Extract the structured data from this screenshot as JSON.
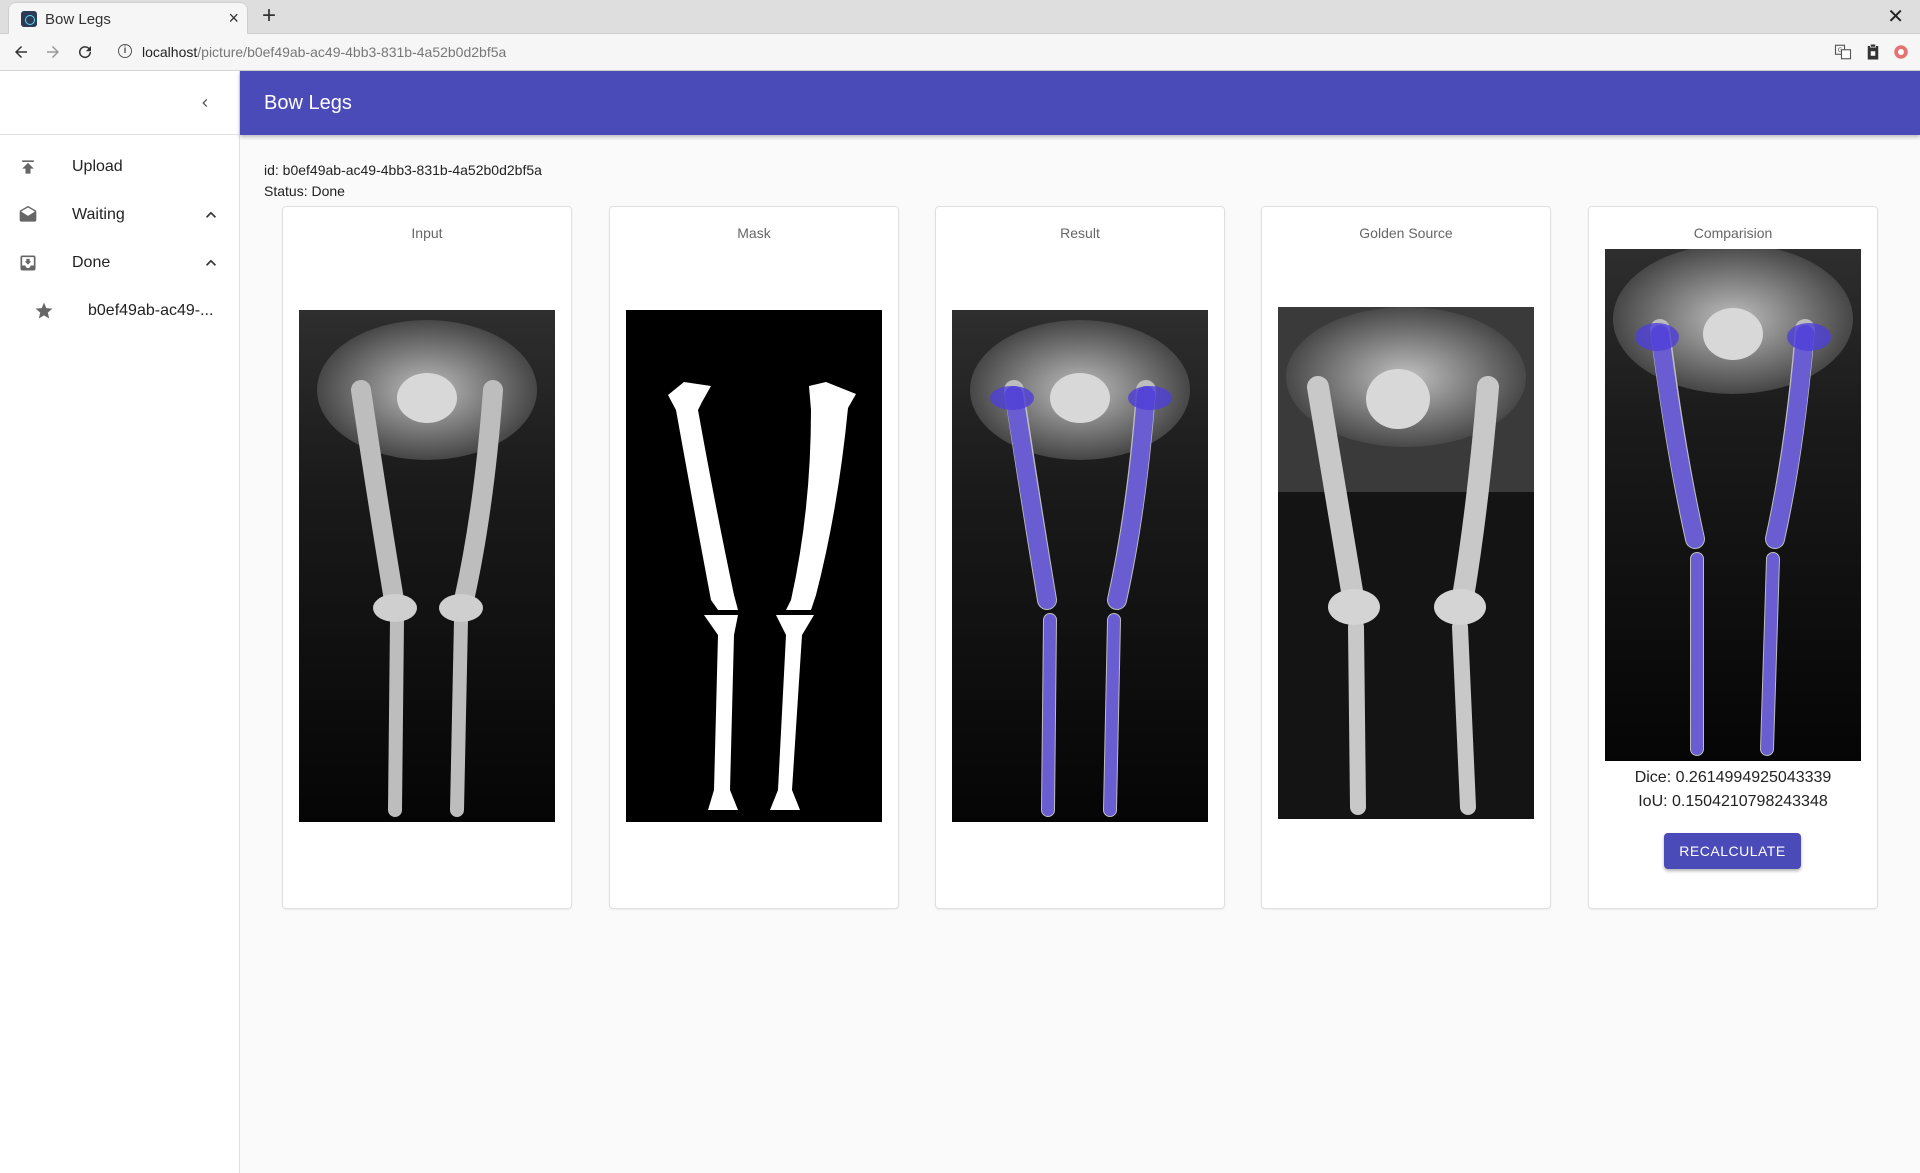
{
  "browser": {
    "tab_title": "Bow Legs",
    "url_host": "localhost",
    "url_path": "/picture/b0ef49ab-ac49-4bb3-831b-4a52b0d2bf5a"
  },
  "app": {
    "title": "Bow Legs"
  },
  "sidebar": {
    "items": [
      {
        "label": "Upload",
        "icon": "upload-icon"
      },
      {
        "label": "Waiting",
        "icon": "drafts-icon",
        "expanded": true
      },
      {
        "label": "Done",
        "icon": "move-to-inbox-icon",
        "expanded": true
      },
      {
        "label": "b0ef49ab-ac49-...",
        "icon": "star-icon"
      }
    ]
  },
  "picture": {
    "id_line": "id: b0ef49ab-ac49-4bb3-831b-4a52b0d2bf5a",
    "status_line": "Status: Done"
  },
  "cards": [
    {
      "title": "Input"
    },
    {
      "title": "Mask"
    },
    {
      "title": "Result"
    },
    {
      "title": "Golden Source"
    },
    {
      "title": "Comparision"
    }
  ],
  "comparison": {
    "dice": "Dice: 0.2614994925043339",
    "iou": "IoU: 0.1504210798243348",
    "button": "RECALCULATE"
  },
  "colors": {
    "accent": "#4a4ab8",
    "overlay": "#4f3ed8"
  }
}
